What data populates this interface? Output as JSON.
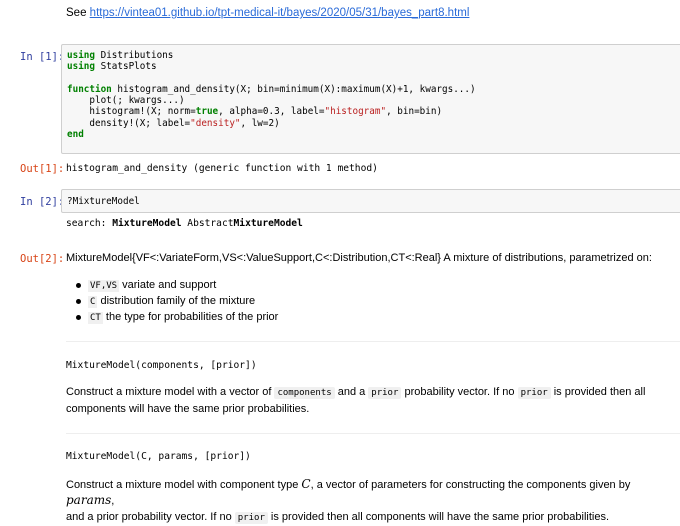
{
  "see": {
    "prefix": "See ",
    "link": "https://vintea01.github.io/tpt-medical-it/bayes/2020/05/31/bayes_part8.html"
  },
  "cell1": {
    "in_prompt": "In [1]:",
    "code": {
      "l1_kw": "using",
      "l1_rest": " Distributions",
      "l2_kw": "using",
      "l2_rest": " StatsPlots",
      "l4_kw": "function",
      "l4_rest": " histogram_and_density(X; bin=minimum(X):maximum(X)+1, kwargs...)",
      "l5": "    plot(; kwargs...)",
      "l6_a": "    histogram!(X; norm=",
      "l6_kw": "true",
      "l6_b": ", alpha=0.3, label=",
      "l6_str": "\"histogram\"",
      "l6_c": ", bin=bin)",
      "l7_a": "    density!(X; label=",
      "l7_str": "\"density\"",
      "l7_b": ", lw=2)",
      "l8_kw": "end"
    },
    "out_prompt": "Out[1]:",
    "output": "histogram_and_density (generic function with 1 method)"
  },
  "cell2": {
    "in_prompt": "In [2]:",
    "code": "?MixtureModel",
    "search_label": "search: ",
    "search_hit1_bold": "MixtureModel",
    "search_hit2_pre": " Abstract",
    "search_hit2_bold": "MixtureModel",
    "out_prompt": "Out[2]:",
    "doc": {
      "intro": "MixtureModel{VF<:VariateForm,VS<:ValueSupport,C<:Distribution,CT<:Real} A mixture of distributions, parametrized on:",
      "params": [
        {
          "code": "VF,VS",
          "text": " variate and support"
        },
        {
          "code": "C",
          "text": " distribution family of the mixture"
        },
        {
          "code": "CT",
          "text": " the type for probabilities of the prior"
        }
      ],
      "sig1": "MixtureModel(components, [prior])",
      "desc1_a": "Construct a mixture model with a vector of ",
      "desc1_code1": "components",
      "desc1_b": " and a ",
      "desc1_code2": "prior",
      "desc1_c": " probability vector. If no ",
      "desc1_code3": "prior",
      "desc1_d": " is provided then all",
      "desc1_line2": "components will have the same prior probabilities.",
      "sig2": "MixtureModel(C, params, [prior])",
      "desc2_a": "Construct a mixture model with component type ",
      "desc2_math1": "C",
      "desc2_b": ", a vector of parameters for constructing the components given by ",
      "desc2_math2": "params",
      "desc2_c": ",",
      "desc2_line2_a": "and a prior probability vector. If no ",
      "desc2_code": "prior",
      "desc2_line2_b": " is provided then all components will have the same prior probabilities."
    }
  }
}
